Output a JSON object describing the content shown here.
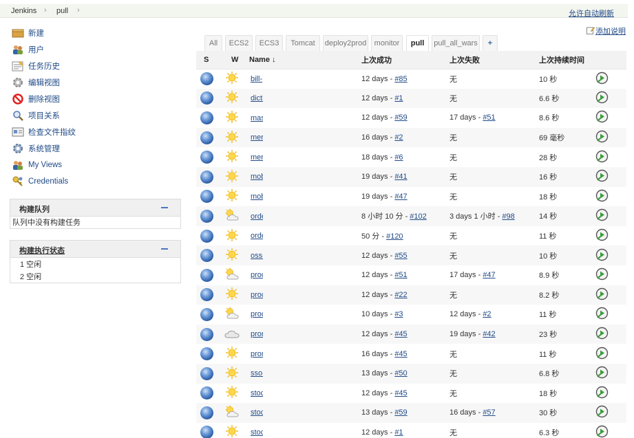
{
  "breadcrumb": {
    "root": "Jenkins",
    "view": "pull"
  },
  "header": {
    "auto_refresh": "允许自动刷新",
    "add_description": "添加说明"
  },
  "sidebar": {
    "items": [
      {
        "label": "新建",
        "icon": "new-package-icon"
      },
      {
        "label": "用户",
        "icon": "users-icon"
      },
      {
        "label": "任务历史",
        "icon": "notepad-icon"
      },
      {
        "label": "编辑视图",
        "icon": "gear-icon"
      },
      {
        "label": "删除视图",
        "icon": "no-entry-icon"
      },
      {
        "label": "项目关系",
        "icon": "magnifier-icon"
      },
      {
        "label": "检查文件指纹",
        "icon": "fingerprint-card-icon"
      },
      {
        "label": "系统管理",
        "icon": "gear-icon"
      },
      {
        "label": "My Views",
        "icon": "users-icon"
      },
      {
        "label": "Credentials",
        "icon": "credentials-icon"
      }
    ]
  },
  "build_queue": {
    "title": "构建队列",
    "empty": "队列中没有构建任务"
  },
  "executors": {
    "title": "构建执行状态",
    "rows": [
      "1 空闲",
      "2 空闲"
    ]
  },
  "tabs": [
    "All",
    "ECS2",
    "ECS3",
    "Tomcat",
    "deploy2prod",
    "monitor",
    "pull",
    "pull_all_wars",
    "+"
  ],
  "active_tab": "pull",
  "table": {
    "headers": [
      "S",
      "W",
      "Name ↓",
      "上次成功",
      "上次失败",
      "上次持续时间"
    ],
    "rows": [
      {
        "name": "bill-",
        "weather": "sunny",
        "success_text": "12 days - ",
        "success_link": "#85",
        "fail_text": "无",
        "fail_link": "",
        "duration": "10 秒"
      },
      {
        "name": "dicti",
        "weather": "sunny",
        "success_text": "12 days - ",
        "success_link": "#1",
        "fail_text": "无",
        "fail_link": "",
        "duration": "6.6 秒"
      },
      {
        "name": "mas",
        "weather": "sunny",
        "success_text": "12 days - ",
        "success_link": "#59",
        "fail_text": "17 days - ",
        "fail_link": "#51",
        "duration": "8.6 秒"
      },
      {
        "name": "mer",
        "weather": "sunny",
        "success_text": "16 days - ",
        "success_link": "#2",
        "fail_text": "无",
        "fail_link": "",
        "duration": "69 毫秒"
      },
      {
        "name": "mer",
        "weather": "sunny",
        "success_text": "18 days - ",
        "success_link": "#6",
        "fail_text": "无",
        "fail_link": "",
        "duration": "28 秒"
      },
      {
        "name": "mob",
        "weather": "sunny",
        "success_text": "19 days - ",
        "success_link": "#41",
        "fail_text": "无",
        "fail_link": "",
        "duration": "16 秒"
      },
      {
        "name": "mob",
        "weather": "sunny",
        "success_text": "19 days - ",
        "success_link": "#47",
        "fail_text": "无",
        "fail_link": "",
        "duration": "18 秒"
      },
      {
        "name": "orde",
        "weather": "partly",
        "success_text": "8 小时 10 分 - ",
        "success_link": "#102",
        "fail_text": "3 days 1 小时 - ",
        "fail_link": "#98",
        "duration": "14 秒"
      },
      {
        "name": "orde",
        "weather": "sunny",
        "success_text": "50 分 - ",
        "success_link": "#120",
        "fail_text": "无",
        "fail_link": "",
        "duration": "11 秒"
      },
      {
        "name": "oss-",
        "weather": "sunny",
        "success_text": "12 days - ",
        "success_link": "#55",
        "fail_text": "无",
        "fail_link": "",
        "duration": "10 秒"
      },
      {
        "name": "proc",
        "weather": "partly",
        "success_text": "12 days - ",
        "success_link": "#51",
        "fail_text": "17 days - ",
        "fail_link": "#47",
        "duration": "8.9 秒"
      },
      {
        "name": "proc",
        "weather": "sunny",
        "success_text": "12 days - ",
        "success_link": "#22",
        "fail_text": "无",
        "fail_link": "",
        "duration": "8.2 秒"
      },
      {
        "name": "proc",
        "weather": "partly",
        "success_text": "10 days - ",
        "success_link": "#3",
        "fail_text": "12 days - ",
        "fail_link": "#2",
        "duration": "11 秒"
      },
      {
        "name": "pron",
        "weather": "cloudy",
        "success_text": "12 days - ",
        "success_link": "#45",
        "fail_text": "19 days - ",
        "fail_link": "#42",
        "duration": "23 秒"
      },
      {
        "name": "pron",
        "weather": "sunny",
        "success_text": "16 days - ",
        "success_link": "#45",
        "fail_text": "无",
        "fail_link": "",
        "duration": "11 秒"
      },
      {
        "name": "sso-",
        "weather": "sunny",
        "success_text": "13 days - ",
        "success_link": "#50",
        "fail_text": "无",
        "fail_link": "",
        "duration": "6.8 秒"
      },
      {
        "name": "stoc",
        "weather": "sunny",
        "success_text": "12 days - ",
        "success_link": "#45",
        "fail_text": "无",
        "fail_link": "",
        "duration": "18 秒"
      },
      {
        "name": "stoc",
        "weather": "partly",
        "success_text": "13 days - ",
        "success_link": "#59",
        "fail_text": "16 days - ",
        "fail_link": "#57",
        "duration": "30 秒"
      },
      {
        "name": "stoc",
        "weather": "sunny",
        "success_text": "12 days - ",
        "success_link": "#1",
        "fail_text": "无",
        "fail_link": "",
        "duration": "6.3 秒"
      }
    ]
  }
}
